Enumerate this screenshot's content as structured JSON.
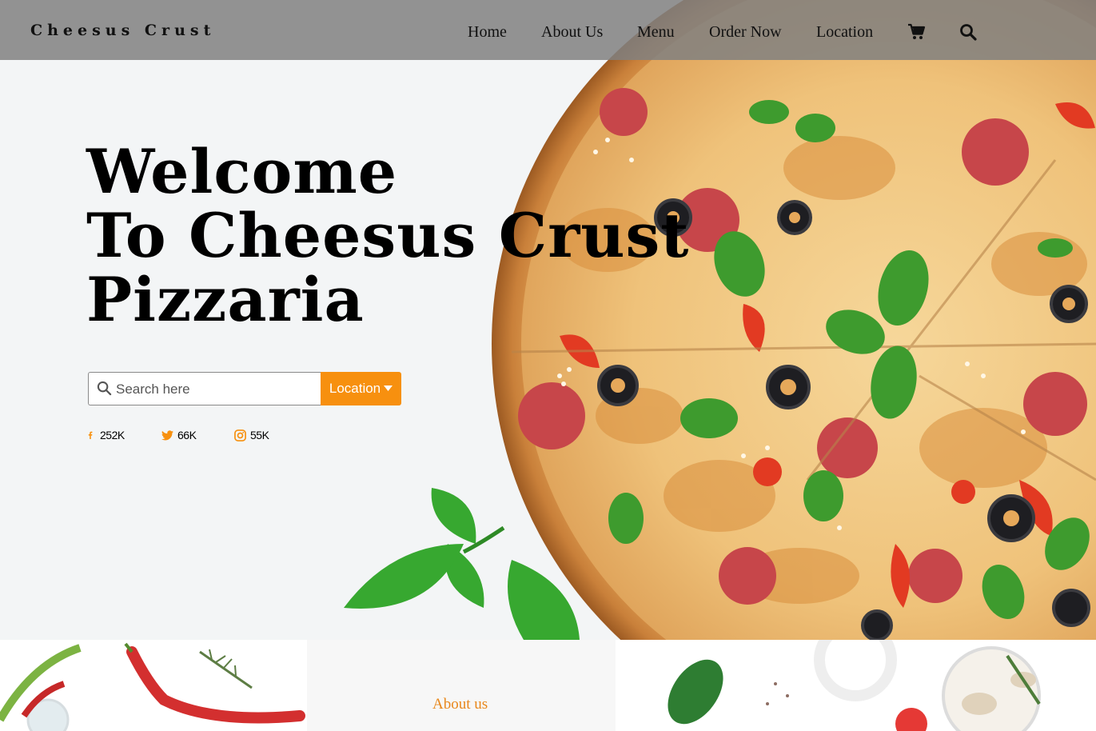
{
  "header": {
    "brand": "Cheesus Crust",
    "nav": [
      "Home",
      "About Us",
      "Menu",
      "Order Now",
      "Location"
    ],
    "icons": [
      "cart-icon",
      "search-icon"
    ]
  },
  "hero": {
    "title_lines": [
      "Welcome",
      "To Cheesus Crust",
      "Pizzaria"
    ],
    "search": {
      "placeholder": "Search here",
      "value": ""
    },
    "location_button": "Location",
    "social": [
      {
        "icon": "facebook-icon",
        "count": "252K"
      },
      {
        "icon": "twitter-icon",
        "count": "66K"
      },
      {
        "icon": "instagram-icon",
        "count": "55K"
      }
    ]
  },
  "bottom": {
    "about_link": "About us"
  },
  "colors": {
    "accent": "#f7900f",
    "header_bg": "#808080",
    "page_bg": "#f3f5f6",
    "about_link": "#e8871a"
  }
}
